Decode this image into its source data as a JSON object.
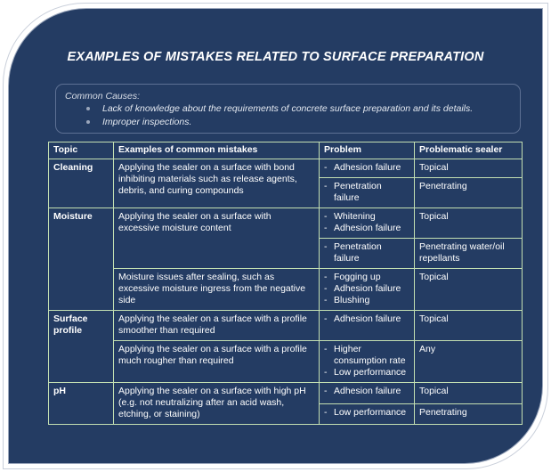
{
  "slide": {
    "title": "EXAMPLES OF MISTAKES RELATED TO SURFACE PREPARATION",
    "background_color": "#243c63",
    "frame_color": "#ffffff",
    "table_border_color": "#c3dfb2"
  },
  "causes": {
    "heading": "Common Causes:",
    "items": [
      "Lack of knowledge about the requirements of concrete surface preparation and its details.",
      "Improper inspections."
    ]
  },
  "table": {
    "headers": {
      "topic": "Topic",
      "mistake": "Examples of common mistakes",
      "problem": "Problem",
      "sealer": "Problematic sealer"
    },
    "rows": [
      {
        "topic": "Cleaning",
        "mistake": "Applying the sealer on a surface with bond inhibiting materials such as release agents, debris, and curing compounds",
        "sub": [
          {
            "problems": [
              "Adhesion failure"
            ],
            "sealer": "Topical"
          },
          {
            "problems": [
              "Penetration failure"
            ],
            "sealer": "Penetrating"
          }
        ]
      },
      {
        "topic": "Moisture",
        "mistakes": [
          {
            "mistake": "Applying the sealer on a surface with excessive moisture content",
            "sub": [
              {
                "problems": [
                  "Whitening",
                  "Adhesion failure"
                ],
                "sealer": "Topical"
              },
              {
                "problems": [
                  "Penetration failure"
                ],
                "sealer": "Penetrating water/oil repellants"
              }
            ]
          },
          {
            "mistake": "Moisture issues after sealing, such as excessive moisture ingress from the negative side",
            "sub": [
              {
                "problems": [
                  "Fogging up",
                  "Adhesion failure",
                  "Blushing"
                ],
                "sealer": "Topical"
              }
            ]
          }
        ]
      },
      {
        "topic": "Surface profile",
        "mistakes": [
          {
            "mistake": "Applying the sealer on a surface with a profile smoother than required",
            "sub": [
              {
                "problems": [
                  "Adhesion failure"
                ],
                "sealer": "Topical"
              }
            ]
          },
          {
            "mistake": "Applying the sealer on a surface with a profile much rougher than required",
            "sub": [
              {
                "problems": [
                  "Higher consumption rate",
                  "Low performance"
                ],
                "sealer": "Any"
              }
            ]
          }
        ]
      },
      {
        "topic": "pH",
        "mistake": "Applying the sealer on a surface with high pH (e.g. not neutralizing after an acid wash, etching, or staining)",
        "sub": [
          {
            "problems": [
              "Adhesion failure"
            ],
            "sealer": "Topical"
          },
          {
            "problems": [
              "Low performance"
            ],
            "sealer": "Penetrating"
          }
        ]
      }
    ]
  }
}
